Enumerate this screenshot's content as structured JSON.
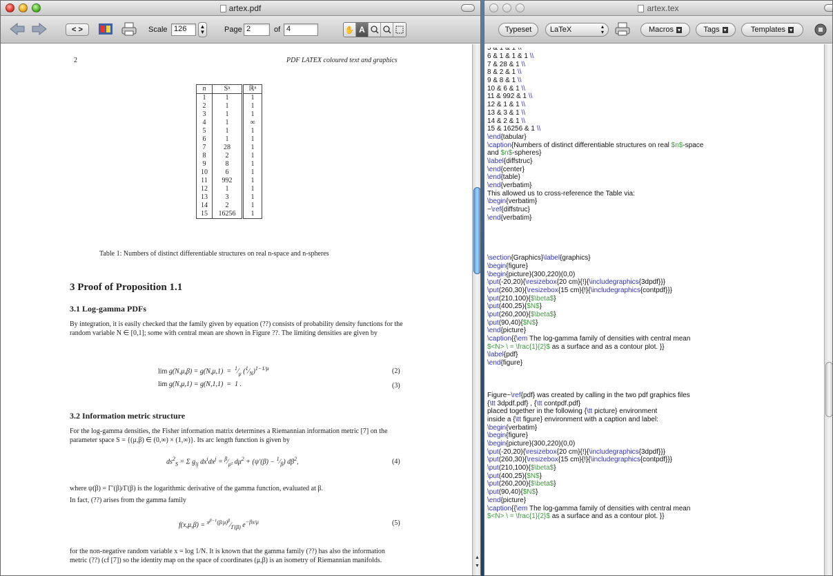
{
  "pdf_window": {
    "title": "artex.pdf",
    "toolbar": {
      "scale_label": "Scale",
      "scale_value": "126",
      "page_label": "Page",
      "page_value": "2",
      "of_label": "of",
      "page_count": "4"
    },
    "page": {
      "number": "2",
      "running_head": "PDF LATEX coloured text and graphics",
      "table": {
        "headers": [
          "n",
          "Sⁿ",
          "ℝⁿ"
        ],
        "rows": [
          [
            "1",
            "1",
            "1"
          ],
          [
            "2",
            "1",
            "1"
          ],
          [
            "3",
            "1",
            "1"
          ],
          [
            "4",
            "1",
            "∞"
          ],
          [
            "5",
            "1",
            "1"
          ],
          [
            "6",
            "1",
            "1"
          ],
          [
            "7",
            "28",
            "1"
          ],
          [
            "8",
            "2",
            "1"
          ],
          [
            "9",
            "8",
            "1"
          ],
          [
            "10",
            "6",
            "1"
          ],
          [
            "11",
            "992",
            "1"
          ],
          [
            "12",
            "1",
            "1"
          ],
          [
            "13",
            "3",
            "1"
          ],
          [
            "14",
            "2",
            "1"
          ],
          [
            "15",
            "16256",
            "1"
          ]
        ],
        "caption": "Table 1: Numbers of distinct differentiable structures on real n-space and n-spheres"
      },
      "section3_title": "3   Proof of Proposition 1.1",
      "sub31_title": "3.1   Log-gamma PDFs",
      "para1": "By integration, it is easily checked that the family given by equation (??) consists of probability density functions for the random variable N ∈ [0,1]; some with central mean are shown in Figure ??. The limiting densities are given by",
      "eq2": "lim g(N,μ,β) = g(N,μ,1)  =  1/μ (1/N)^(1−1/μ)",
      "eq2_num": "(2)",
      "eq3": "lim g(N,μ,1) = g(N,1,1)  =  1 .",
      "eq3_num": "(3)",
      "sub32_title": "3.2   Information metric structure",
      "para2": "For the log-gamma densities, the Fisher information matrix determines a Riemannian information metric [7] on the parameter space S = {(μ,β) ∈ (0,∞) × (1,∞)}. Its arc length function is given by",
      "eq4": "ds²_S = Σ g_ij dx^i dx^j = β/μ² dμ² + (ψ′(β) − 1/β) dβ²,",
      "eq4_num": "(4)",
      "para3": "where ψ(β) = Γ′(β)/Γ(β) is the logarithmic derivative of the gamma function, evaluated at β.",
      "para4": "In fact, (??) arises from the gamma family",
      "eq5": "f(x,μ,β) = x^(β−1) (β/μ)^β / Γ(β) · e^(−β x/μ)",
      "eq5_num": "(5)",
      "para5": "for the non-negative random variable x = log 1/N. It is known that the gamma family (??) has also the information metric (??) (cf [7]) so the identity map on the space of coordinates (μ,β) is an isometry of Riemannian manifolds."
    }
  },
  "tex_window": {
    "title": "artex.tex",
    "toolbar": {
      "typeset": "Typeset",
      "engine": "LaTeX",
      "macros": "Macros",
      "tags": "Tags",
      "templates": "Templates"
    },
    "source_lines": [
      "6 & 1 & 1 & 1 \\\\",
      "7 & 28 & 1 \\\\",
      "8 & 2 & 1 \\\\",
      "9 & 8 & 1 \\\\",
      "10 & 6 & 1 \\\\",
      "11 & 992 & 1 \\\\",
      "12 & 1 & 1 \\\\",
      "13 & 3 & 1 \\\\",
      "14 & 2 & 1 \\\\",
      "15 & 16256 & 1 \\\\",
      "\\end{tabular}",
      "\\caption{Numbers of distinct differentiable structures on real $n$-space",
      "and $n$-spheres}",
      "\\label{diffstruc}",
      "\\end{center}",
      "\\end{table}",
      "\\end{verbatim}",
      "This allowed us to cross-reference the Table via:",
      "\\begin{verbatim}",
      "~\\ref{diffstruc}",
      "\\end{verbatim}",
      "",
      "",
      "",
      "",
      "\\section{Graphics}\\label{graphics}",
      "\\begin{figure}",
      "\\begin{picture}(300,220)(0,0)",
      "\\put(-20,20){\\resizebox{20 cm}{!}{\\includegraphics{3dpdf}}}",
      "\\put(260,30){\\resizebox{15 cm}{!}{\\includegraphics{contpdf}}}",
      "\\put(210,100){$\\beta$}",
      "\\put(400,25){$N$}",
      "\\put(260,200){$\\beta$}",
      "\\put(90,40){$N$}",
      "\\end{picture}",
      "\\caption{{\\em The log-gamma family of densities with central mean",
      "$<N> \\ = \\frac{1}{2}$ as a surface and as a contour plot. }}",
      "\\label{pdf}",
      "\\end{figure}",
      "",
      "",
      "",
      "Figure~\\ref{pdf} was created by calling in the two pdf graphics files",
      "{\\tt 3dpdf.pdf} , {\\tt contpdf.pdf}",
      "placed together in the following {\\tt picture} environment",
      "inside a {\\tt figure} environment with a caption and label:",
      "\\begin{verbatim}",
      "\\begin{figure}",
      "\\begin{picture}(300,220)(0,0)",
      "\\put(-20,20){\\resizebox{20 cm}{!}{\\includegraphics{3dpdf}}}",
      "\\put(260,30){\\resizebox{15 cm}{!}{\\includegraphics{contpdf}}}",
      "\\put(210,100){$\\beta$}",
      "\\put(400,25){$N$}",
      "\\put(260,200){$\\beta$}",
      "\\put(90,40){$N$}",
      "\\end{picture}",
      "\\caption{{\\em The log-gamma family of densities with central mean",
      "$<N> \\ = \\frac{1}{2}$ as a surface and as a contour plot. }}"
    ]
  },
  "colors": {
    "tex_keyword": "#3030c8",
    "tex_math": "#3e9a3e",
    "scroll_thumb": "#5f9ed9"
  }
}
